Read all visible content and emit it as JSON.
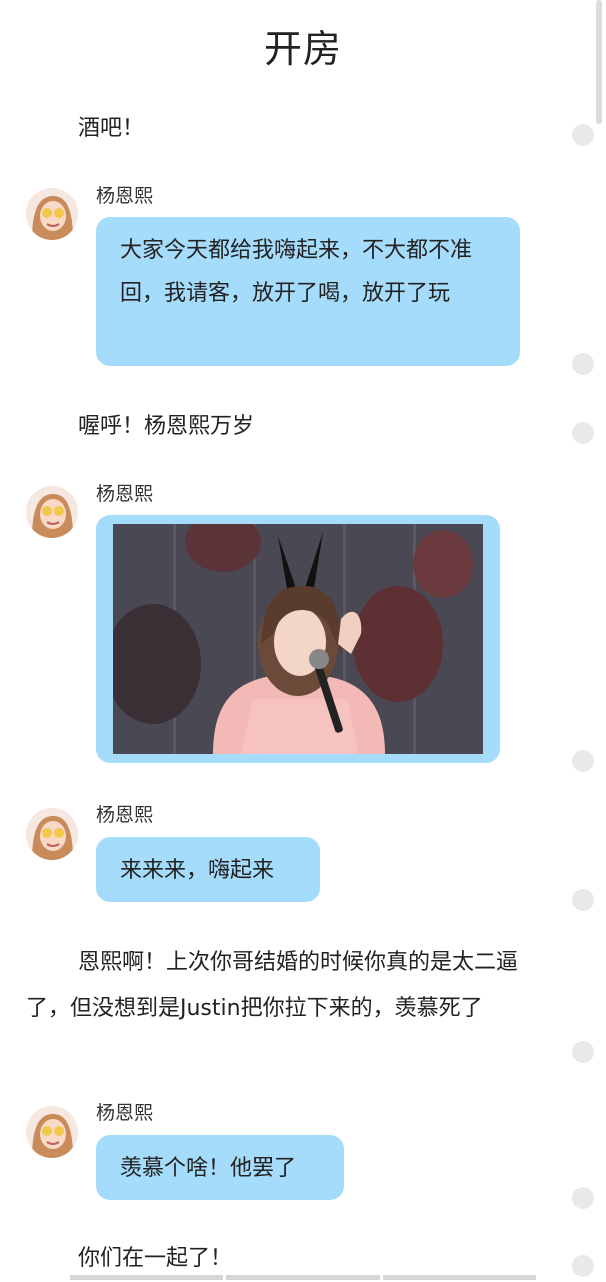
{
  "header": {
    "title": "开房"
  },
  "messages": [
    {
      "kind": "narration",
      "text": "酒吧！"
    },
    {
      "kind": "speech",
      "speaker": "杨恩熙",
      "text": "大家今天都给我嗨起来，不大都不准回，我请客，放开了喝，放开了玩"
    },
    {
      "kind": "narration",
      "text": "喔呼！杨恩熙万岁"
    },
    {
      "kind": "image",
      "speaker": "杨恩熙"
    },
    {
      "kind": "speech",
      "speaker": "杨恩熙",
      "text": "来来来，嗨起来"
    },
    {
      "kind": "narration",
      "text": "恩熙啊！上次你哥结婚的时候你真的是太二逼了，但没想到是Justin把你拉下来的，羡慕死了"
    },
    {
      "kind": "speech",
      "speaker": "杨恩熙",
      "text": "羡慕个啥！他罢了"
    },
    {
      "kind": "narration",
      "text": "你们在一起了！"
    }
  ],
  "colors": {
    "bubble": "#a6dcfb",
    "text": "#222222",
    "dot": "#e9e9e9"
  },
  "icons": {
    "avatar": "avatar-icon",
    "comment_dot": "comment-dot-icon"
  }
}
